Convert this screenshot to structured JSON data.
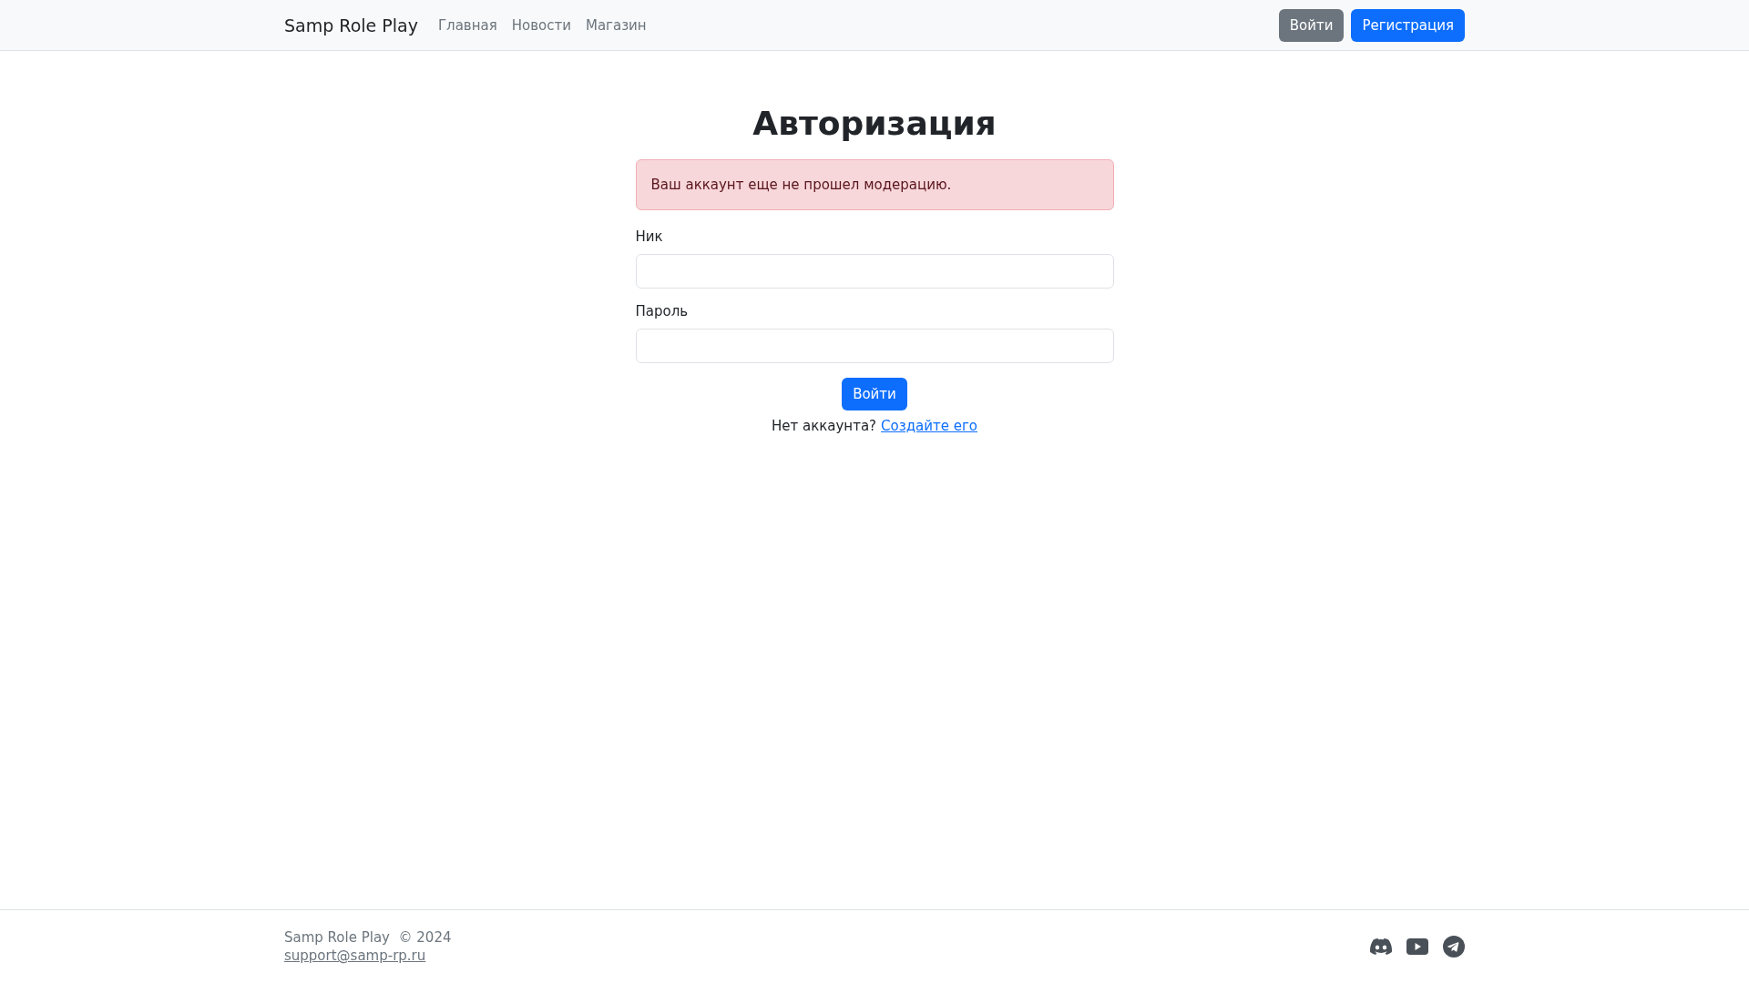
{
  "navbar": {
    "brand": "Samp Role Play",
    "links": [
      {
        "label": "Главная"
      },
      {
        "label": "Новости"
      },
      {
        "label": "Магазин"
      }
    ],
    "buttons": [
      {
        "label": "Войти",
        "kind": "secondary"
      },
      {
        "label": "Регистрация",
        "kind": "primary"
      }
    ]
  },
  "form": {
    "title": "Авторизация",
    "alert": "Ваш аккаунт еще не прошел модерацию.",
    "fields": [
      {
        "label": "Ник"
      },
      {
        "label": "Пароль"
      }
    ],
    "submit": "Войти",
    "signup_prompt": "Нет аккаунта?",
    "signup_link": "Создайте его"
  },
  "footer": {
    "copyright": "Samp Role Play  © 2024",
    "email": "support@samp-rp.ru",
    "social": [
      {
        "kind": "discord"
      },
      {
        "kind": "youtube"
      },
      {
        "kind": "telegram"
      }
    ]
  }
}
